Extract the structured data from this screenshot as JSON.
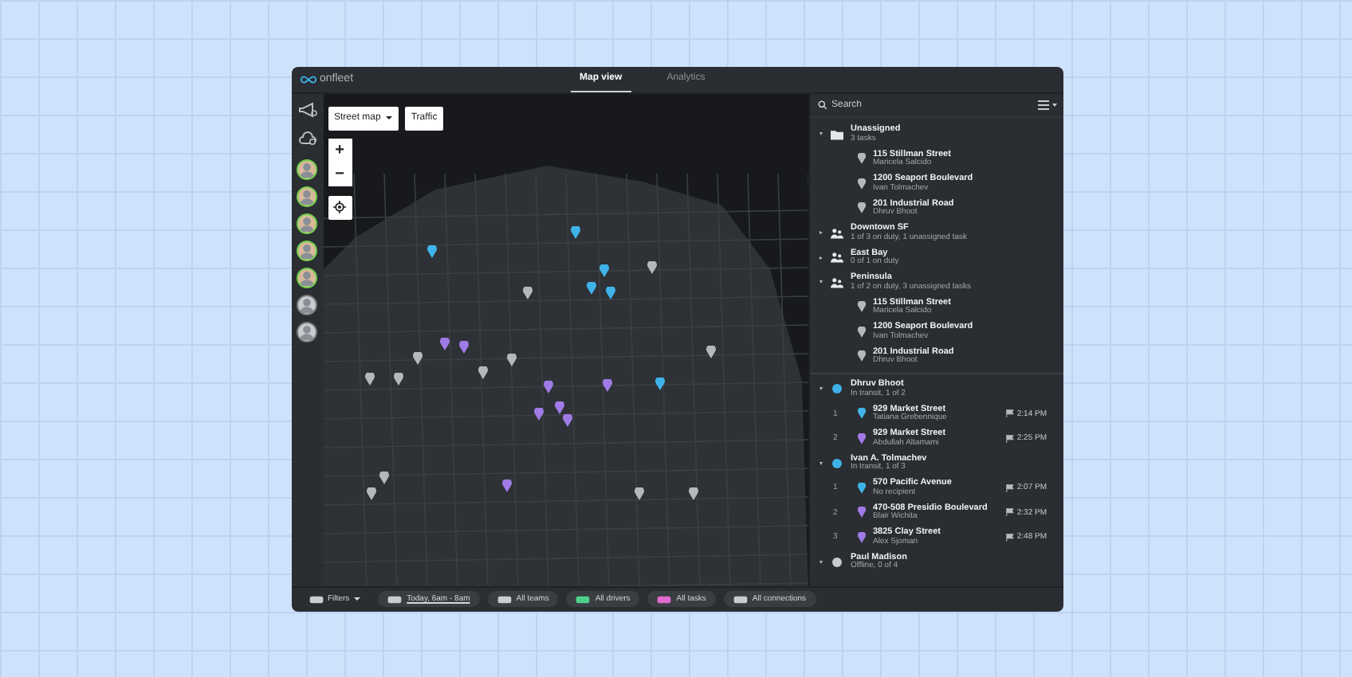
{
  "logo": {
    "text": "onfleet"
  },
  "tabs": [
    {
      "label": "Map view",
      "selected": true
    },
    {
      "label": "Analytics",
      "selected": false
    }
  ],
  "map_controls": {
    "map_type": "Street map",
    "traffic": "Traffic",
    "zoom_in": "+",
    "zoom_out": "−"
  },
  "sidebar": {
    "avatars": [
      {
        "online": true
      },
      {
        "online": true
      },
      {
        "online": true
      },
      {
        "online": true
      },
      {
        "online": true
      },
      {
        "online": false
      },
      {
        "online": false
      }
    ]
  },
  "panel": {
    "search": {
      "placeholder": "Search"
    },
    "groups": [
      {
        "kind": "folder",
        "title": "Unassigned",
        "subtitle": "3 tasks",
        "expanded": true,
        "tasks": [
          {
            "address": "115 Stillman Street",
            "person": "Maricela Salcido",
            "color": "#b4b8bd"
          },
          {
            "address": "1200 Seaport Boulevard",
            "person": "Ivan Tolmachev",
            "color": "#b4b8bd"
          },
          {
            "address": "201 Industrial Road",
            "person": "Dhruv Bhoot",
            "color": "#b4b8bd"
          }
        ]
      },
      {
        "kind": "team",
        "title": "Downtown SF",
        "subtitle": "1 of 3 on duty, 1 unassigned task",
        "expanded": false
      },
      {
        "kind": "team",
        "title": "East Bay",
        "subtitle": "0 of 1 on duty",
        "expanded": false
      },
      {
        "kind": "team",
        "title": "Peninsula",
        "subtitle": "1 of 2 on duty, 3 unassigned tasks",
        "expanded": true,
        "tasks": [
          {
            "address": "115 Stillman Street",
            "person": "Maricela Salcido",
            "color": "#b4b8bd"
          },
          {
            "address": "1200 Seaport Boulevard",
            "person": "Ivan Tolmachev",
            "color": "#b4b8bd"
          },
          {
            "address": "201 Industrial Road",
            "person": "Dhruv Bhoot",
            "color": "#b4b8bd"
          }
        ]
      },
      {
        "kind": "driver",
        "title": "Dhruv Bhoot",
        "subtitle": "In transit, 1 of 2",
        "expanded": true,
        "color": "#3fb3e8",
        "tasks": [
          {
            "number": "1",
            "address": "929 Market Street",
            "person": "Tatiana Grebennique",
            "time": "2:14 PM",
            "color": "#3fb3e8"
          },
          {
            "number": "2",
            "address": "929 Market Street",
            "person": "Abdullah Altamami",
            "time": "2:25 PM",
            "color": "#a07ae6"
          }
        ]
      },
      {
        "kind": "driver",
        "title": "Ivan A. Tolmachev",
        "subtitle": "In transit, 1 of 3",
        "expanded": true,
        "color": "#3fb3e8",
        "tasks": [
          {
            "number": "1",
            "address": "570 Pacific Avenue",
            "person": "No recipient",
            "time": "2:07 PM",
            "color": "#3fb3e8"
          },
          {
            "number": "2",
            "address": "470-508 Presidio Boulevard",
            "person": "Blair Wichita",
            "time": "2:32 PM",
            "color": "#a07ae6"
          },
          {
            "number": "3",
            "address": "3825 Clay Street",
            "person": "Alex Sjoman",
            "time": "2:48 PM",
            "color": "#a07ae6"
          }
        ]
      },
      {
        "kind": "driver",
        "title": "Paul Madison",
        "subtitle": "Offline, 0 of 4",
        "expanded": true,
        "color": "#c8cacc"
      }
    ]
  },
  "filters": [
    {
      "kind": "filters",
      "label": "Filters"
    },
    {
      "kind": "date",
      "label": "Today, 6am - 8am"
    },
    {
      "kind": "teams",
      "label": "All teams"
    },
    {
      "kind": "drivers",
      "label": "All drivers"
    },
    {
      "kind": "tasks",
      "label": "All tasks"
    },
    {
      "kind": "connections",
      "label": "All connections"
    }
  ]
}
